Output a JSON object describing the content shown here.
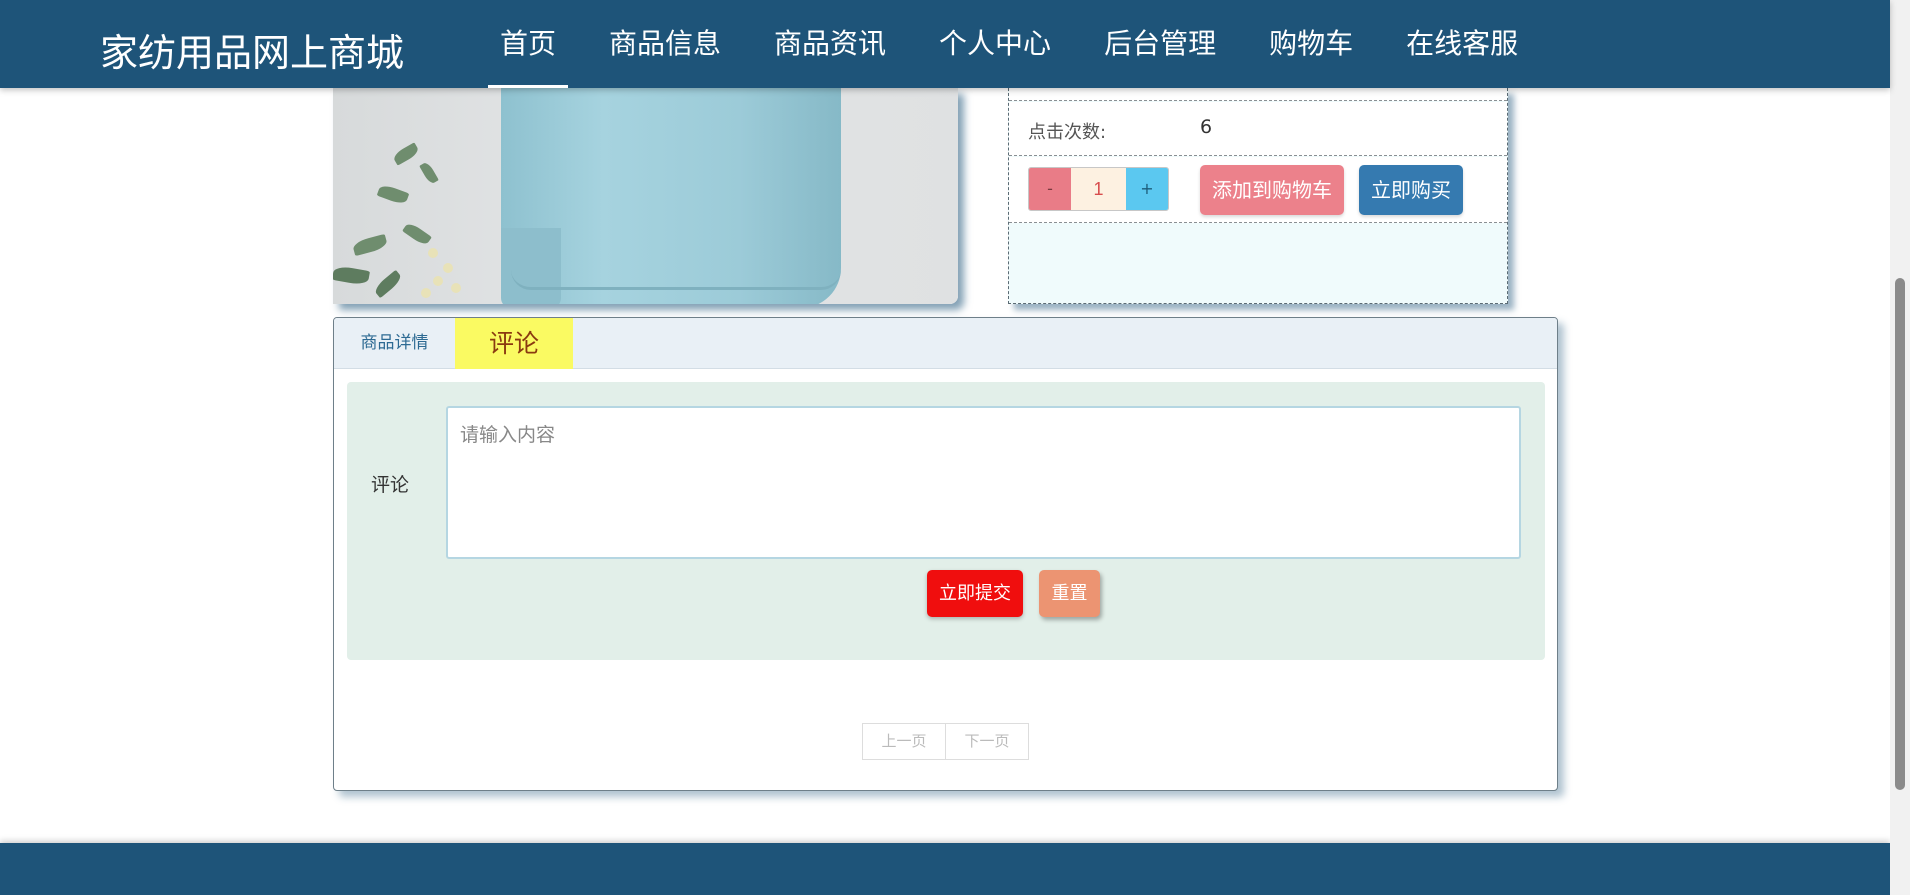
{
  "header": {
    "brand": "家纺用品网上商城",
    "nav": [
      "首页",
      "商品信息",
      "商品资讯",
      "个人中心",
      "后台管理",
      "购物车",
      "在线客服"
    ],
    "active_index": 0
  },
  "product": {
    "image_icon": "product-photo-blue-sweater",
    "clicks_label": "点击次数:",
    "clicks_value": "6",
    "qty_minus": "-",
    "qty_value": "1",
    "qty_plus": "+",
    "add_to_cart": "添加到购物车",
    "buy_now": "立即购买"
  },
  "tabs": {
    "detail": "商品详情",
    "review": "评论",
    "active": "review"
  },
  "review_form": {
    "label": "评论",
    "placeholder": "请输入内容",
    "value": "",
    "submit": "立即提交",
    "reset": "重置"
  },
  "pager": {
    "prev": "上一页",
    "next": "下一页"
  },
  "colors": {
    "header_bg": "#1e5479",
    "tab_active_bg": "#fafa62",
    "submit_bg": "#f00e0e",
    "reset_bg": "#ec9472",
    "cart_bg": "#ec818b",
    "buy_bg": "#357ab0"
  }
}
